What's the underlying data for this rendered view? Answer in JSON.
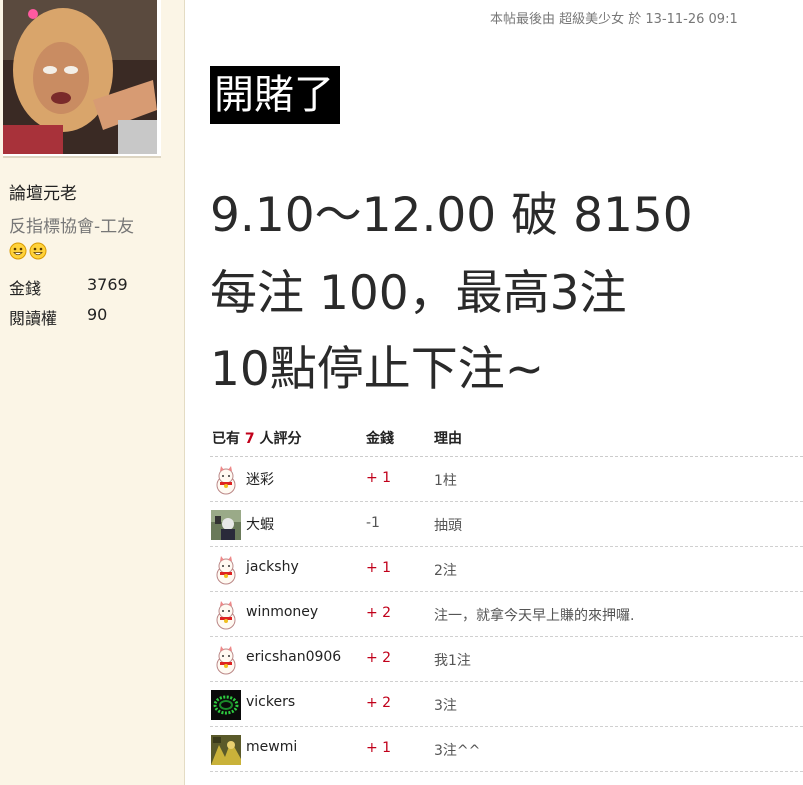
{
  "sidebar": {
    "avatar_label": "avatar",
    "rank": "論壇元老",
    "group": "反指標協會-工友",
    "stats": [
      {
        "label": "金錢",
        "value": "3769"
      },
      {
        "label": "閱讀權",
        "value": "90"
      }
    ]
  },
  "post": {
    "meta": "本帖最後由 超級美少女 於 13-11-26 09:1",
    "title": "開賭了",
    "line1": "9.10～12.00 破 8150",
    "line2": "每注 100，最高3注",
    "line3": "10點停止下注~"
  },
  "ratings": {
    "head_prefix": "已有",
    "head_count": "7",
    "head_suffix": "人評分",
    "col_money": "金錢",
    "col_reason": "理由",
    "rows": [
      {
        "name": "迷彩",
        "score": "+ 1",
        "reason": "1柱",
        "icon": "lucky-cat-icon"
      },
      {
        "name": "大蝦",
        "score": "-1",
        "reason": "抽頭",
        "icon": "user-photo-icon"
      },
      {
        "name": "jackshy",
        "score": "+ 1",
        "reason": "2注",
        "icon": "lucky-cat-icon"
      },
      {
        "name": "winmoney",
        "score": "+ 2",
        "reason": "注一，就拿今天早上賺的來押囉.",
        "icon": "lucky-cat-icon"
      },
      {
        "name": "ericshan0906",
        "score": "+ 2",
        "reason": "我1注",
        "icon": "lucky-cat-icon"
      },
      {
        "name": "vickers",
        "score": "+ 2",
        "reason": "3注",
        "icon": "green-ring-icon"
      },
      {
        "name": "mewmi",
        "score": "+ 1",
        "reason": "3注^^",
        "icon": "user-photo-icon"
      }
    ]
  },
  "colors": {
    "accent_red": "#c1001a",
    "sidebar_bg": "#fbf5e6"
  }
}
